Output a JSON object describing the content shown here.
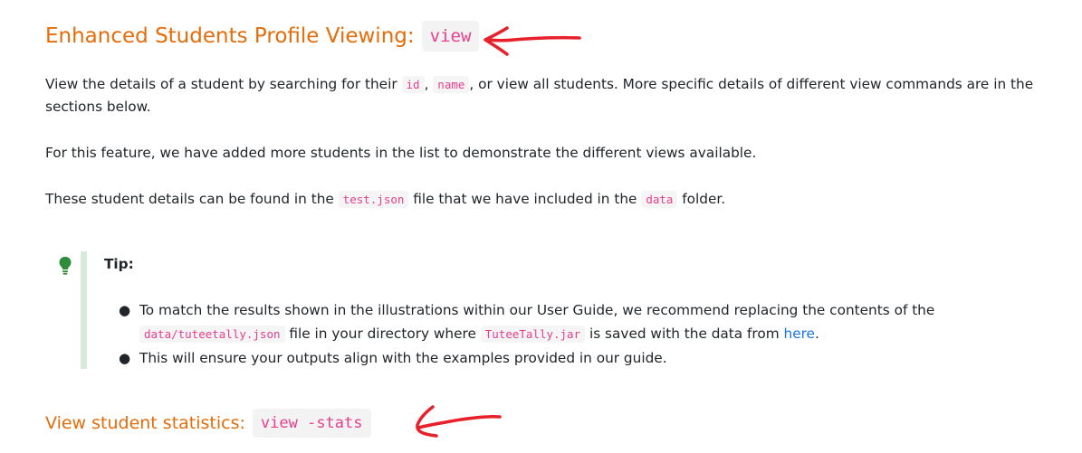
{
  "heading1": {
    "text": "Enhanced Students Profile Viewing:",
    "code": "view"
  },
  "para1": {
    "t1": "View the details of a student by searching for their ",
    "c1": "id",
    "t2": ", ",
    "c2": "name",
    "t3": ", or view all students. More specific details of different view commands are in the sections below."
  },
  "para2": {
    "text": "For this feature, we have added more students in the list to demonstrate the different views available."
  },
  "para3": {
    "t1": "These student details can be found in the ",
    "c1": "test.json",
    "t2": " file that we have included in the ",
    "c2": "data",
    "t3": " folder."
  },
  "tip": {
    "title": "Tip:",
    "items": [
      {
        "t1": "To match the results shown in the illustrations within our User Guide, we recommend replacing the contents of the ",
        "c1": "data/tuteetally.json",
        "t2": " file in your directory where ",
        "c2": "TuteeTally.jar",
        "t3": " is saved with the data from ",
        "link": "here",
        "t4": "."
      },
      {
        "text": "This will ensure your outputs align with the examples provided in our guide."
      }
    ],
    "icon": "lightbulb-icon",
    "icon_color": "#2e8b3a"
  },
  "heading2": {
    "text": "View student statistics:",
    "code": "view -stats"
  },
  "colors": {
    "heading": "#e46c0a",
    "code": "#e83e8c",
    "link": "#1a73e8",
    "annotation": "#e8202a",
    "tip_border": "#d6e9dd"
  }
}
